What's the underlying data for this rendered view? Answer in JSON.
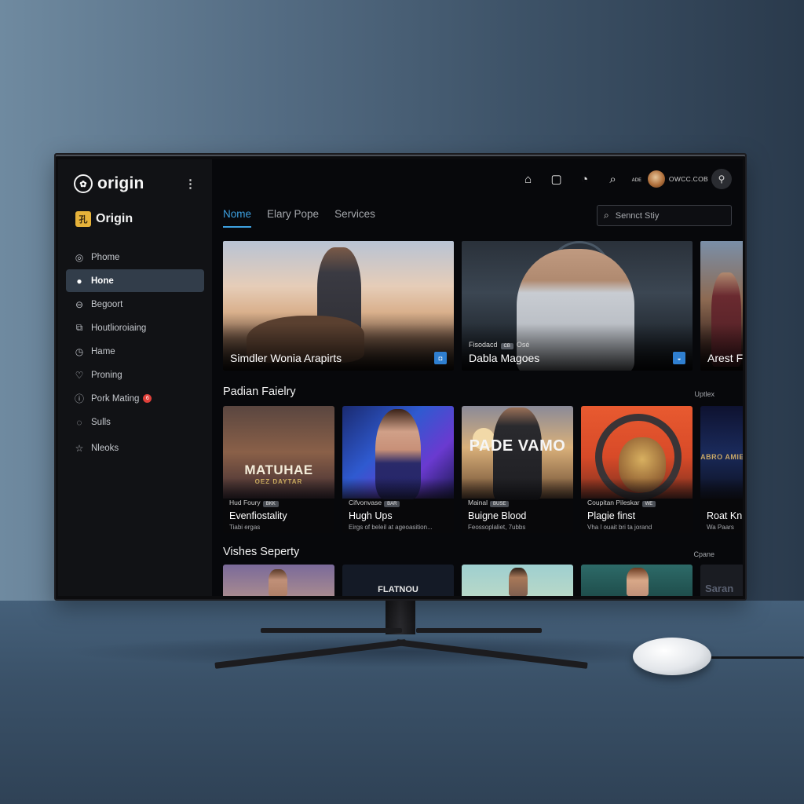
{
  "app": {
    "brand_name": "origin",
    "account_name": "Origin"
  },
  "sidebar": {
    "items": [
      {
        "label": "Phome",
        "icon": "disc-icon",
        "glyph": "◎",
        "active": false
      },
      {
        "label": "Hone",
        "icon": "user-icon",
        "glyph": "●",
        "active": true
      },
      {
        "label": "Begoort",
        "icon": "lock-icon",
        "glyph": "⊖",
        "active": false
      },
      {
        "label": "Houtlioroiaing",
        "icon": "gallery-icon",
        "glyph": "⧉",
        "active": false
      },
      {
        "label": "Hame",
        "icon": "timer-icon",
        "glyph": "◷",
        "active": false
      },
      {
        "label": "Proning",
        "icon": "heart-icon",
        "glyph": "♡",
        "active": false
      },
      {
        "label": "Pork Mating",
        "icon": "info-icon",
        "glyph": "ⓘ",
        "active": false,
        "badge": "6"
      },
      {
        "label": "Sulls",
        "icon": "chat-icon",
        "glyph": "◌",
        "active": false
      },
      {
        "label": "Nleoks",
        "icon": "star-icon",
        "glyph": "☆",
        "active": false
      }
    ]
  },
  "topbar": {
    "icons": [
      {
        "name": "home-icon",
        "glyph": "⌂"
      },
      {
        "name": "bookmark-icon",
        "glyph": "▢"
      },
      {
        "name": "gauge-icon",
        "glyph": "◔"
      },
      {
        "name": "search-icon",
        "glyph": "⌕"
      }
    ],
    "label": "ᴀᴅᴇ",
    "user_name": "OWCC.COB"
  },
  "tabs": [
    {
      "label": "Nome",
      "active": true
    },
    {
      "label": "Elary Pope",
      "active": false
    },
    {
      "label": "Services",
      "active": false
    }
  ],
  "search": {
    "placeholder": "Sennct Stiy",
    "value": ""
  },
  "hero": [
    {
      "title": "Simdler Wonia Arapirts",
      "meta": "",
      "badge": "◘"
    },
    {
      "title": "Dabla Magoes",
      "meta": "Fisodacd",
      "meta_pill": "CB",
      "meta_extra": "Osé",
      "badge": "◒"
    },
    {
      "title": "Arest F",
      "meta": "",
      "badge": ""
    }
  ],
  "sections": [
    {
      "title": "Padian Faielry",
      "link": "Uptlex",
      "items": [
        {
          "art_text": "MATUHAE",
          "art_sub": "OEZ DAYTAR",
          "meta": "Hud Foury",
          "pill": "BKK",
          "title": "Evenfiostality",
          "desc": "Tiabi ergas"
        },
        {
          "art_text": "",
          "art_sub": "",
          "meta": "Cifvonvase",
          "pill": "BAR",
          "title": "Hugh Ups",
          "desc": "Eirgs of beleil at ageoasition..."
        },
        {
          "art_text": "PADE VAMO",
          "art_sub": "",
          "meta": "Mainal",
          "pill": "BUSE",
          "title": "Buigne Blood",
          "desc": "Feossoplaliet, 7ubbs"
        },
        {
          "art_text": "",
          "art_sub": "",
          "meta": "Coupitan Pileskar",
          "pill": "WE",
          "title": "Plagie finst",
          "desc": "Vha l ouait bri ta jorand"
        },
        {
          "art_text": "ABRO AMIE",
          "art_sub": "",
          "meta": "",
          "pill": "",
          "title": "Roat Kn",
          "desc": "Wa Paars"
        }
      ]
    },
    {
      "title": "Vishes Seperty",
      "link": "Cpane",
      "items": [
        {
          "art_text": ""
        },
        {
          "art_text": "FLATNOU"
        },
        {
          "art_text": ""
        },
        {
          "art_text": ""
        },
        {
          "art_text": "Saran"
        }
      ]
    }
  ],
  "colors": {
    "accent": "#3da0e0",
    "badge_red": "#e0403a",
    "badge_blue": "#2f7fd0",
    "sidebar_active": "#323d4a"
  }
}
